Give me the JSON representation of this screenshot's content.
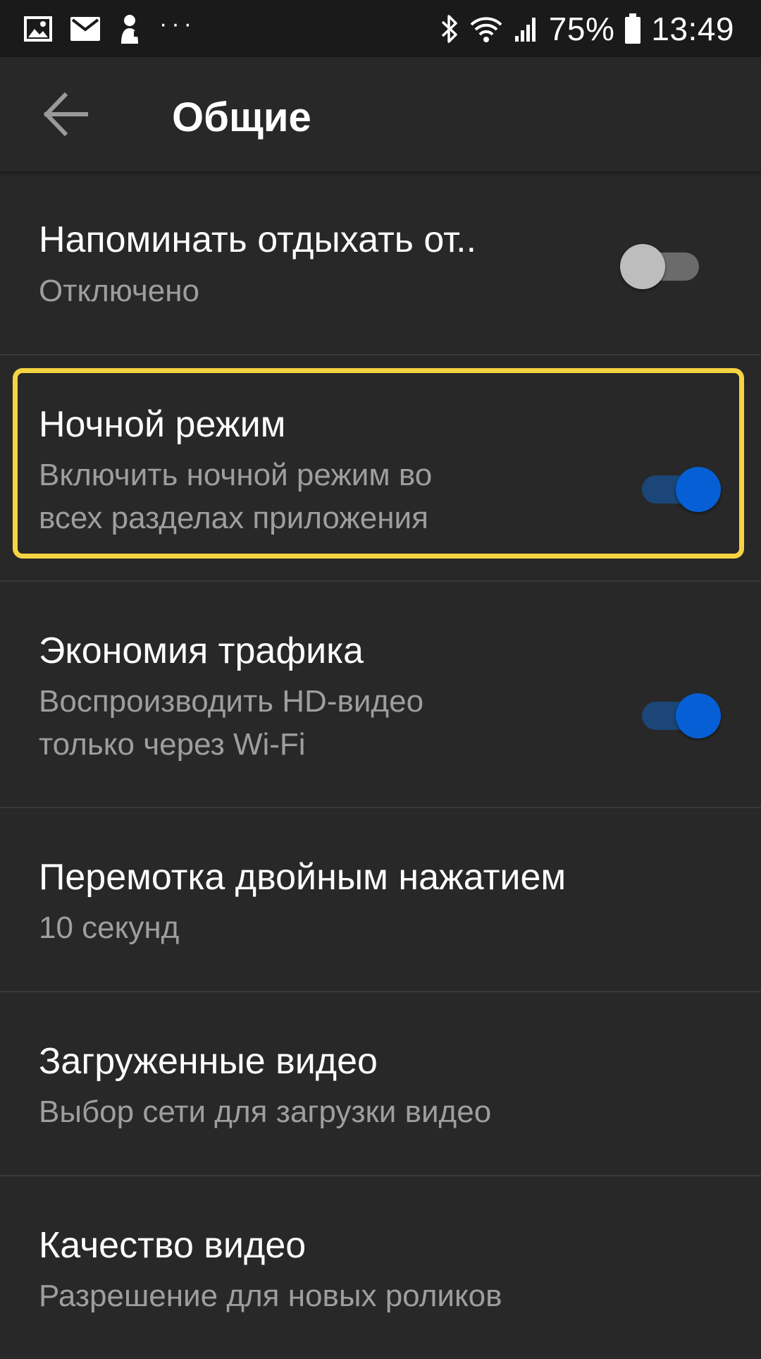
{
  "status_bar": {
    "notification_icons": [
      "image-icon",
      "mail-icon",
      "person-icon"
    ],
    "overflow": "···",
    "battery_percent": "75%",
    "time": "13:49"
  },
  "header": {
    "back_icon": "arrow-left-icon",
    "title": "Общие"
  },
  "settings": [
    {
      "title": "Напоминать отдыхать от..",
      "subtitle": [
        "Отключено"
      ],
      "toggle": "off"
    },
    {
      "title": "Ночной режим",
      "subtitle": [
        "Включить ночной режим во",
        "всех разделах приложения"
      ],
      "toggle": "on",
      "highlighted": true
    },
    {
      "title": "Экономия трафика",
      "subtitle": [
        "Воспроизводить HD-видео",
        "только через Wi-Fi"
      ],
      "toggle": "on"
    },
    {
      "title": "Перемотка двойным нажатием",
      "subtitle": [
        "10 секунд"
      ]
    },
    {
      "title": "Загруженные видео",
      "subtitle": [
        "Выбор сети для загрузки видео"
      ]
    },
    {
      "title": "Качество видео",
      "subtitle": [
        "Разрешение для новых роликов"
      ]
    }
  ],
  "colors": {
    "background": "#282828",
    "highlight": "#f5d443",
    "toggle_on": "#065fd4"
  }
}
